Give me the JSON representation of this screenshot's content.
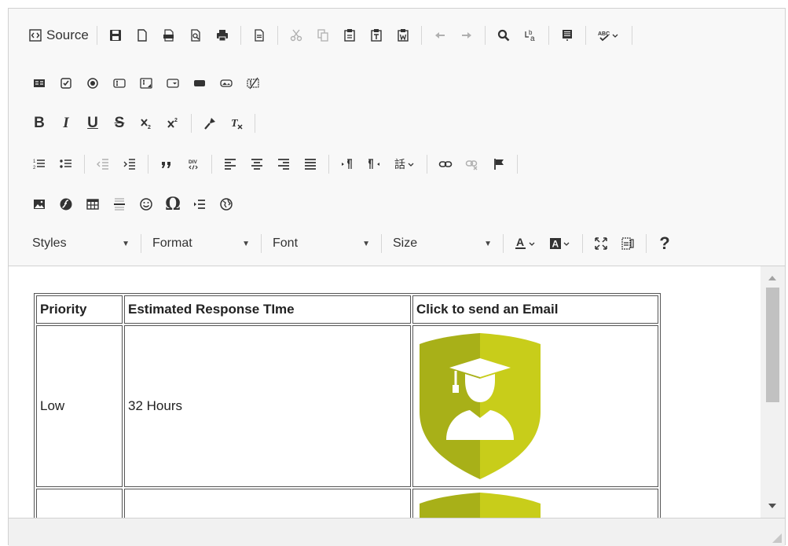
{
  "toolbar": {
    "source_label": "Source",
    "row1": [
      {
        "name": "source-button"
      },
      {
        "name": "save-icon"
      },
      {
        "name": "new-page-icon"
      },
      {
        "name": "export-pdf-icon"
      },
      {
        "name": "preview-icon"
      },
      {
        "name": "print-icon"
      },
      {
        "name": "templates-icon"
      },
      {
        "name": "cut-icon"
      },
      {
        "name": "copy-icon"
      },
      {
        "name": "paste-icon"
      },
      {
        "name": "paste-text-icon"
      },
      {
        "name": "paste-word-icon"
      },
      {
        "name": "undo-icon"
      },
      {
        "name": "redo-icon"
      },
      {
        "name": "find-icon"
      },
      {
        "name": "replace-icon"
      },
      {
        "name": "select-all-icon"
      },
      {
        "name": "spellcheck-icon"
      }
    ],
    "styles_label": "Styles",
    "format_label": "Format",
    "font_label": "Font",
    "size_label": "Size",
    "help_label": "?"
  },
  "table": {
    "headers": [
      "Priority",
      "Estimated Response TIme",
      "Click to send an Email"
    ],
    "rows": [
      {
        "priority": "Low",
        "response_time": "32 Hours",
        "email_icon": "graduate-shield-icon"
      }
    ]
  },
  "colors": {
    "shield_left": "#a8b018",
    "shield_right": "#c8cd1a",
    "toolbar_bg": "#f8f8f8"
  }
}
